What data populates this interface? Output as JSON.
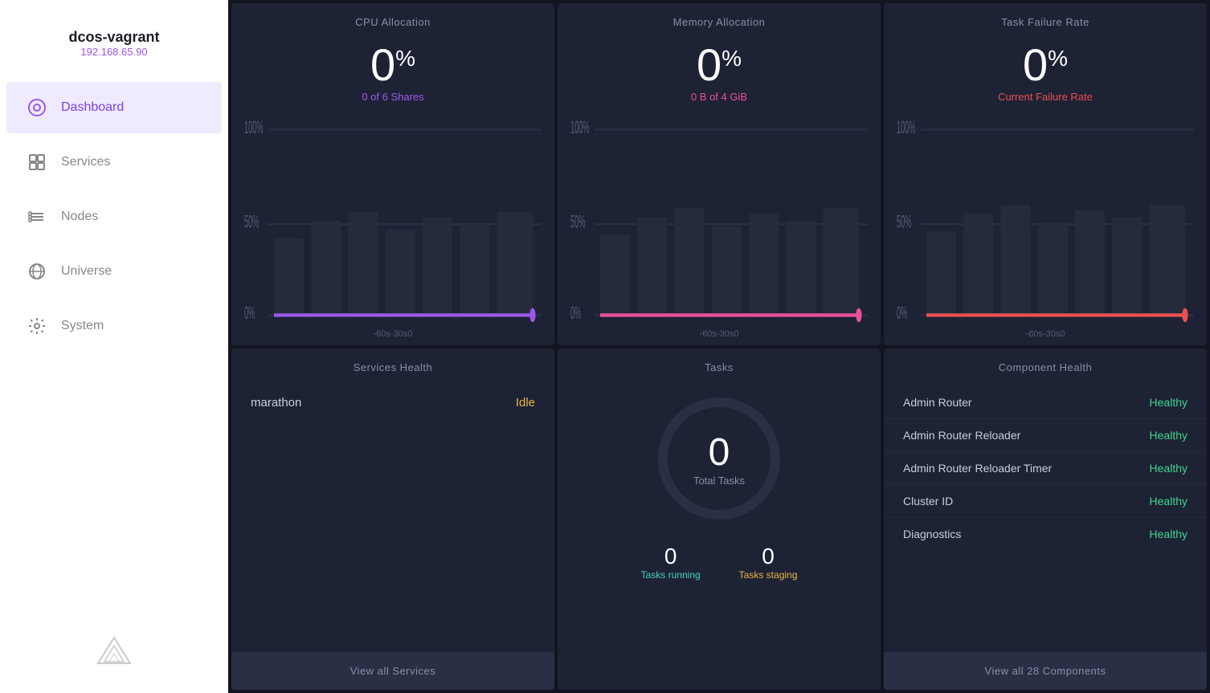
{
  "sidebar": {
    "brand": {
      "name": "dcos-vagrant",
      "ip": "192.168.65.90"
    },
    "nav": [
      {
        "id": "dashboard",
        "label": "Dashboard",
        "icon": "dashboard-icon",
        "active": true
      },
      {
        "id": "services",
        "label": "Services",
        "icon": "services-icon",
        "active": false
      },
      {
        "id": "nodes",
        "label": "Nodes",
        "icon": "nodes-icon",
        "active": false
      },
      {
        "id": "universe",
        "label": "Universe",
        "icon": "universe-icon",
        "active": false
      },
      {
        "id": "system",
        "label": "System",
        "icon": "system-icon",
        "active": false
      }
    ]
  },
  "cpu": {
    "title": "CPU Allocation",
    "value": "0",
    "pct": "%",
    "sub": "0 of 6 Shares",
    "yLabels": [
      "100%",
      "50%",
      "0%"
    ],
    "xLabels": [
      "-60s",
      "-30s",
      "0"
    ]
  },
  "memory": {
    "title": "Memory Allocation",
    "value": "0",
    "pct": "%",
    "sub": "0 B of 4 GiB",
    "yLabels": [
      "100%",
      "50%",
      "0%"
    ],
    "xLabels": [
      "-60s",
      "-30s",
      "0"
    ]
  },
  "taskFailure": {
    "title": "Task Failure Rate",
    "value": "0",
    "pct": "%",
    "sub": "Current Failure Rate",
    "yLabels": [
      "100%",
      "50%",
      "0%"
    ],
    "xLabels": [
      "-60s",
      "-30s",
      "0"
    ]
  },
  "servicesHealth": {
    "title": "Services Health",
    "services": [
      {
        "name": "marathon",
        "status": "Idle",
        "statusClass": "status-idle"
      }
    ],
    "footerBtn": "View all Services"
  },
  "tasks": {
    "title": "Tasks",
    "total": "0",
    "totalLabel": "Total Tasks",
    "running": "0",
    "runningLabel": "Tasks running",
    "staging": "0",
    "stagingLabel": "Tasks staging"
  },
  "componentHealth": {
    "title": "Component Health",
    "components": [
      {
        "name": "Admin Router",
        "status": "Healthy"
      },
      {
        "name": "Admin Router Reloader",
        "status": "Healthy"
      },
      {
        "name": "Admin Router Reloader Timer",
        "status": "Healthy"
      },
      {
        "name": "Cluster ID",
        "status": "Healthy"
      },
      {
        "name": "Diagnostics",
        "status": "Healthy"
      }
    ],
    "footerBtn": "View all 28 Components"
  }
}
